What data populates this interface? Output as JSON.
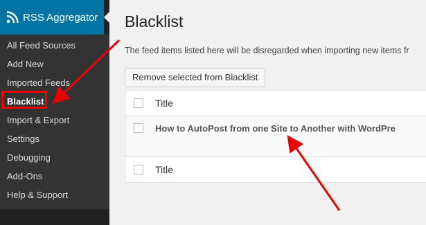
{
  "sidebar": {
    "plugin_title": "RSS Aggregator",
    "items": [
      {
        "label": "All Feed Sources"
      },
      {
        "label": "Add New"
      },
      {
        "label": "Imported Feeds"
      },
      {
        "label": "Blacklist"
      },
      {
        "label": "Import & Export"
      },
      {
        "label": "Settings"
      },
      {
        "label": "Debugging"
      },
      {
        "label": "Add-Ons"
      },
      {
        "label": "Help & Support"
      }
    ],
    "current_item": "Blacklist"
  },
  "main": {
    "title": "Blacklist",
    "description": "The feed items listed here will be disregarded when importing new items fr",
    "remove_button_label": "Remove selected from Blacklist",
    "table": {
      "header_title": "Title",
      "footer_title": "Title",
      "rows": [
        {
          "title": "How to AutoPost from one Site to Another with WordPre"
        }
      ]
    }
  },
  "colors": {
    "sidebar_bg": "#222222",
    "menu_bg": "#333333",
    "plugin_header_bg": "#0074a2",
    "annotation_red": "#e00000"
  }
}
